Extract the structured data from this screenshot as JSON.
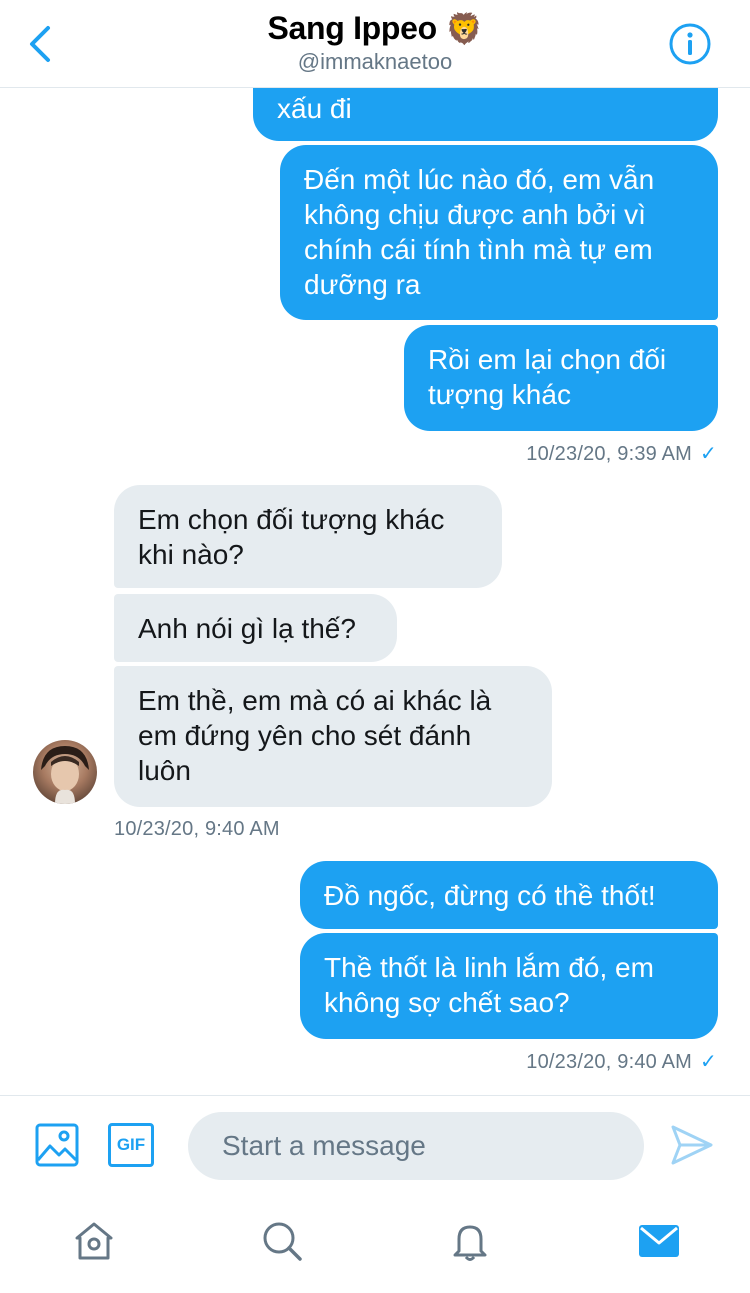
{
  "header": {
    "name": "Sang Ippeo",
    "emoji": "🦁",
    "handle": "@immaknaetoo",
    "back_icon": "chevron-left-icon",
    "info_icon": "info-icon"
  },
  "messages": {
    "m1": "xấu đi",
    "m2": [
      "Đến một lúc nào đó, em vẫn",
      "không chịu được anh bởi vì",
      "chính cái tính tình mà tự em",
      "dưỡng ra"
    ],
    "m3": [
      "Rồi em lại chọn đối",
      "tượng khác"
    ],
    "ts1": "10/23/20, 9:39 AM",
    "m4": [
      "Em chọn đối tượng khác",
      "khi nào?"
    ],
    "m5": "Anh nói gì lạ thế?",
    "m6": [
      "Em thề, em mà có ai khác là",
      "em đứng yên cho sét đánh",
      "luôn"
    ],
    "ts2": "10/23/20, 9:40 AM",
    "m7": "Đồ ngốc, đừng có thề thốt!",
    "m8": [
      "Thề thốt là linh lắm đó, em",
      "không sợ chết sao?"
    ],
    "ts3": "10/23/20, 9:40 AM",
    "check": "✓"
  },
  "composer": {
    "image_icon": "image-icon",
    "gif_label": "GIF",
    "placeholder": "Start a message",
    "send_icon": "send-icon"
  },
  "tabbar": {
    "items": [
      "home-icon",
      "search-icon",
      "notifications-icon",
      "messages-icon"
    ]
  },
  "colors": {
    "accent": "#1da1f2",
    "incoming_bubble": "#e6ecf0",
    "secondary_text": "#657786"
  }
}
